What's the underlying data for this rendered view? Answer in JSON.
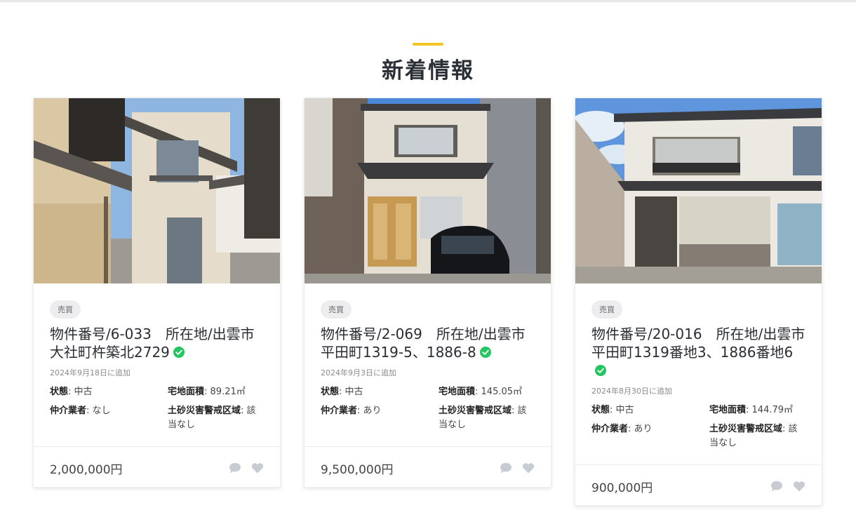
{
  "section": {
    "title": "新着情報",
    "accent_color": "#f3c623"
  },
  "colors": {
    "verified_green": "#22c55e",
    "icon_gray": "#c7ccd3"
  },
  "listings": [
    {
      "badge": "売買",
      "title": "物件番号/6-033　所在地/出雲市大社町杵築北2729",
      "verified_icon": "check-circle-icon",
      "added": "2024年9月18日に追加",
      "status_label": "状態",
      "status_value": ": 中古",
      "area_label": "宅地面積",
      "area_value": ": 89.21㎡",
      "broker_label": "仲介業者",
      "broker_value": ": なし",
      "hazard_label": "土砂災害警戒区域",
      "hazard_value": ": 該当なし",
      "price": "2,000,000円"
    },
    {
      "badge": "売買",
      "title": "物件番号/2-069　所在地/出雲市平田町1319-5、1886-8",
      "verified_icon": "check-circle-icon",
      "added": "2024年9月3日に追加",
      "status_label": "状態",
      "status_value": ": 中古",
      "area_label": "宅地面積",
      "area_value": ": 145.05㎡",
      "broker_label": "仲介業者",
      "broker_value": ": あり",
      "hazard_label": "土砂災害警戒区域",
      "hazard_value": ": 該当なし",
      "price": "9,500,000円"
    },
    {
      "badge": "売買",
      "title": "物件番号/20-016　所在地/出雲市平田町1319番地3、1886番地6",
      "verified_icon": "check-circle-icon",
      "added": "2024年8月30日に追加",
      "status_label": "状態",
      "status_value": ": 中古",
      "area_label": "宅地面積",
      "area_value": ": 144.79㎡",
      "broker_label": "仲介業者",
      "broker_value": ": あり",
      "hazard_label": "土砂災害警戒区域",
      "hazard_value": ": 該当なし",
      "price": "900,000円"
    }
  ]
}
